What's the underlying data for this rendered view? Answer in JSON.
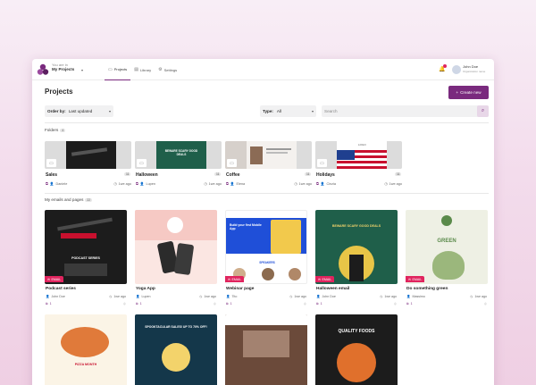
{
  "topbar": {
    "workspace_label": "You are in",
    "workspace_name": "My Projects",
    "nav": [
      {
        "label": "Projects",
        "icon": "folder-icon"
      },
      {
        "label": "Library",
        "icon": "library-icon"
      },
      {
        "label": "Settings",
        "icon": "gear-icon"
      }
    ],
    "user_name": "John Doe",
    "user_org": "Organization name"
  },
  "header": {
    "title": "Projects",
    "create_label": "Create new"
  },
  "filters": {
    "order_label": "Order by:",
    "order_value": "Last updated",
    "type_label": "Type:",
    "type_value": "All",
    "search_placeholder": "Search"
  },
  "folders_section": {
    "label": "Folders",
    "count": "4"
  },
  "folders": [
    {
      "name": "Sales",
      "count": "11",
      "owner": "Daniele",
      "time": "1we ago"
    },
    {
      "name": "Halloween",
      "count": "11",
      "owner": "Lupen",
      "time": "1we ago"
    },
    {
      "name": "Coffee",
      "count": "11",
      "owner": "Elena",
      "time": "1we ago"
    },
    {
      "name": "Holidays",
      "count": "11",
      "owner": "Cinzia",
      "time": "1we ago"
    }
  ],
  "emails_section": {
    "label": "My emails and pages",
    "count": "22"
  },
  "cards": [
    {
      "name": "Podcast series",
      "badge": "EMAIL",
      "owner": "John Doe",
      "time": "1we ago",
      "shares": "1"
    },
    {
      "name": "Yoga App",
      "badge": "",
      "owner": "Lupen",
      "time": "1we ago",
      "shares": "1"
    },
    {
      "name": "Webinar page",
      "badge": "EMAIL",
      "owner": "Tito",
      "time": "1we ago",
      "shares": "1"
    },
    {
      "name": "Halloween email",
      "badge": "EMAIL",
      "owner": "John Doe",
      "time": "1we ago",
      "shares": "1"
    },
    {
      "name": "Do something green",
      "badge": "EMAIL",
      "owner": "Massimo",
      "time": "1we ago",
      "shares": "1"
    }
  ],
  "thumb_text": {
    "halloween_title": "BEWARE SCARY GOOD DEALS",
    "green": "GREEN",
    "podcast": "PODCAST SERIES",
    "webinar": "Build your first Mobile App",
    "webinar_sub": "SPEAKERS",
    "spooktacular": "SPOOKTACULAR SALES! UP TO 70% OFF!",
    "pizza": "PIZZA MONTH",
    "quality": "QUALITY FOODS",
    "logo": "LOGO"
  },
  "colors": {
    "accent": "#7a2a7e",
    "email_badge": "#e0245e",
    "halloween_green": "#1f5f4a",
    "dark_thumb": "#1c1c1c"
  }
}
